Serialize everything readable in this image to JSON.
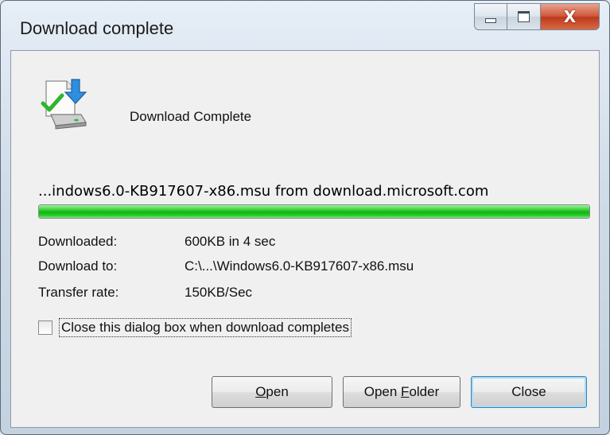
{
  "window": {
    "title": "Download complete",
    "controls": {
      "minimize": "minimize",
      "maximize": "maximize",
      "close": "X"
    }
  },
  "header": {
    "headline": "Download Complete",
    "icon": "download-complete-icon"
  },
  "file": {
    "source_line": "...indows6.0-KB917607-x86.msu from download.microsoft.com"
  },
  "progress": {
    "percent": 100,
    "color": "#11b511"
  },
  "details": [
    {
      "label": "Downloaded:",
      "value": "600KB in 4 sec"
    },
    {
      "label": "Download to:",
      "value": "C:\\...\\Windows6.0-KB917607-x86.msu"
    },
    {
      "label": "Transfer rate:",
      "value": "150KB/Sec"
    }
  ],
  "option": {
    "label": "Close this dialog box when download completes",
    "checked": false
  },
  "buttons": {
    "open": {
      "accel": "O",
      "rest": "pen"
    },
    "open_folder": {
      "pre": "Open ",
      "accel": "F",
      "rest": "older"
    },
    "close": {
      "label": "Close"
    }
  }
}
